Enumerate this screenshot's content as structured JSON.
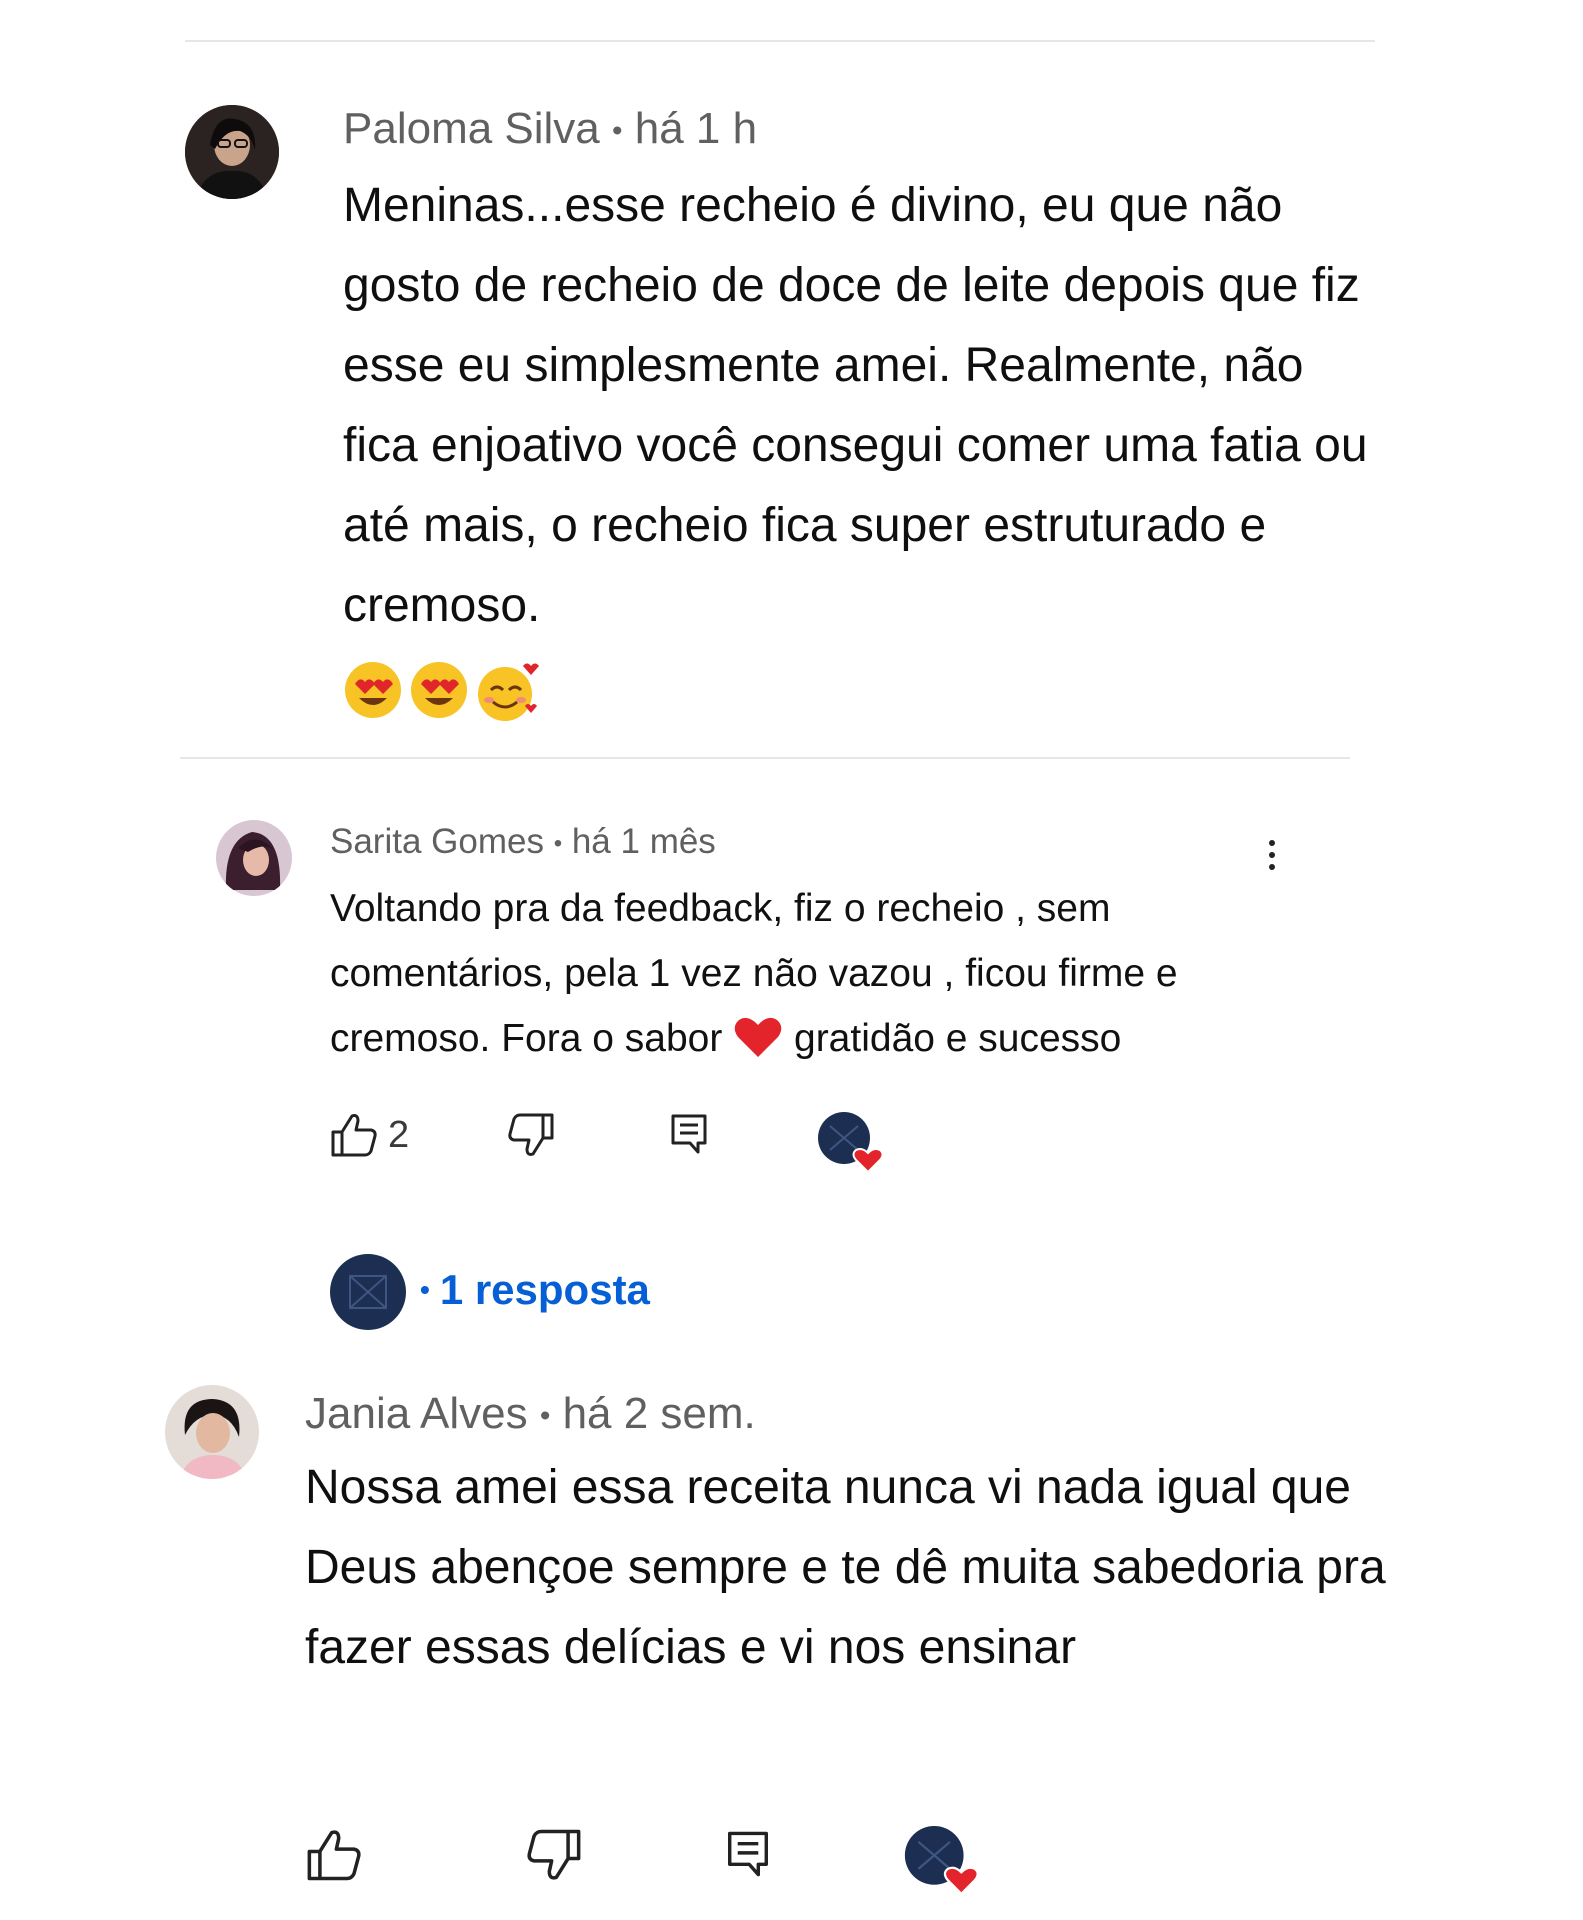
{
  "comments": [
    {
      "author": "Paloma Silva",
      "sep": "•",
      "time": "há 1 h",
      "text": "Meninas...esse recheio é divino, eu que não gosto de recheio de doce de leite depois que fiz esse eu simplesmente amei. Realmente, não fica enjoativo você consegui comer uma fatia ou até mais, o recheio fica super estruturado e cremoso.",
      "emojis": [
        "heart-eyes-face",
        "heart-eyes-face",
        "smiling-face-with-hearts"
      ]
    },
    {
      "author": "Sarita Gomes",
      "sep": "•",
      "time": "há 1 mês",
      "text_before_heart": "Voltando pra da feedback, fiz o recheio , sem comentários, pela 1 vez não vazou , ficou firme e cremoso. Fora o sabor ",
      "text_after_heart": " gratidão e sucesso",
      "like_count": "2",
      "reply_link": "1 resposta",
      "reply_sep": "•"
    },
    {
      "author": "Jania Alves",
      "sep": "•",
      "time": "há 2 sem.",
      "text": "Nossa amei essa receita nunca vi nada igual que Deus abençoe sempre e te dê muita sabedoria pra fazer essas delícias e vi nos ensinar"
    }
  ],
  "colors": {
    "channel_avatar": "#1c2f52",
    "heart": "#e3242b",
    "link": "#065fd4",
    "meta": "#606060"
  },
  "icons": [
    "like-icon",
    "dislike-icon",
    "reply-icon",
    "creator-heart-icon",
    "more-vert-icon"
  ]
}
